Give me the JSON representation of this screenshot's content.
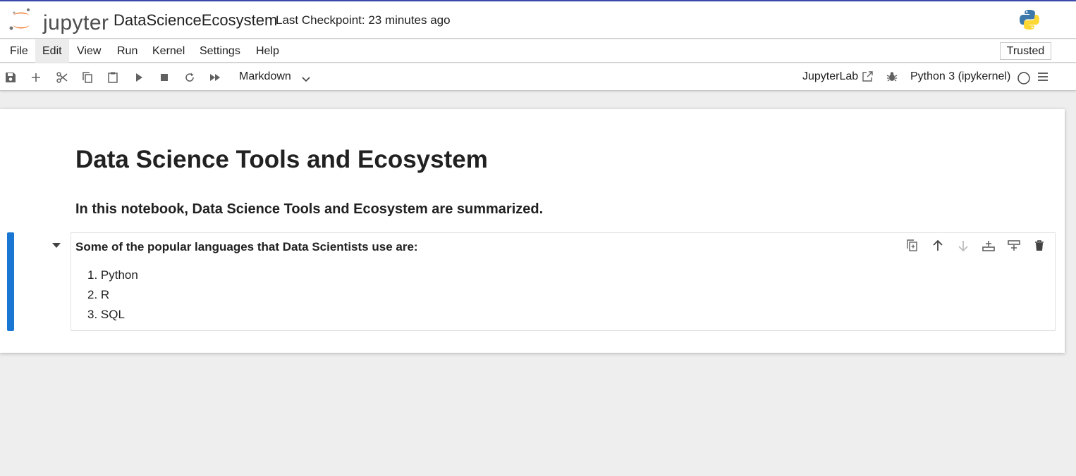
{
  "header": {
    "logo_text": "jupyter",
    "notebook_title": "DataScienceEcosystem",
    "checkpoint": "Last Checkpoint: 23 minutes ago"
  },
  "menubar": {
    "items": [
      "File",
      "Edit",
      "View",
      "Run",
      "Kernel",
      "Settings",
      "Help"
    ],
    "trusted": "Trusted"
  },
  "toolbar": {
    "cell_type": "Markdown",
    "jupyterlab_link": "JupyterLab",
    "kernel": "Python 3 (ipykernel)"
  },
  "notebook": {
    "title": "Data Science Tools and Ecosystem",
    "intro": "In this notebook, Data Science Tools and Ecosystem are summarized.",
    "cell_heading": "Some of the popular languages that Data Scientists use are:",
    "languages": [
      "1. Python",
      "2. R",
      "3. SQL"
    ]
  },
  "colors": {
    "accent": "#1976d2",
    "top_bar": "#3949ab",
    "jupyter_orange": "#f37626"
  }
}
